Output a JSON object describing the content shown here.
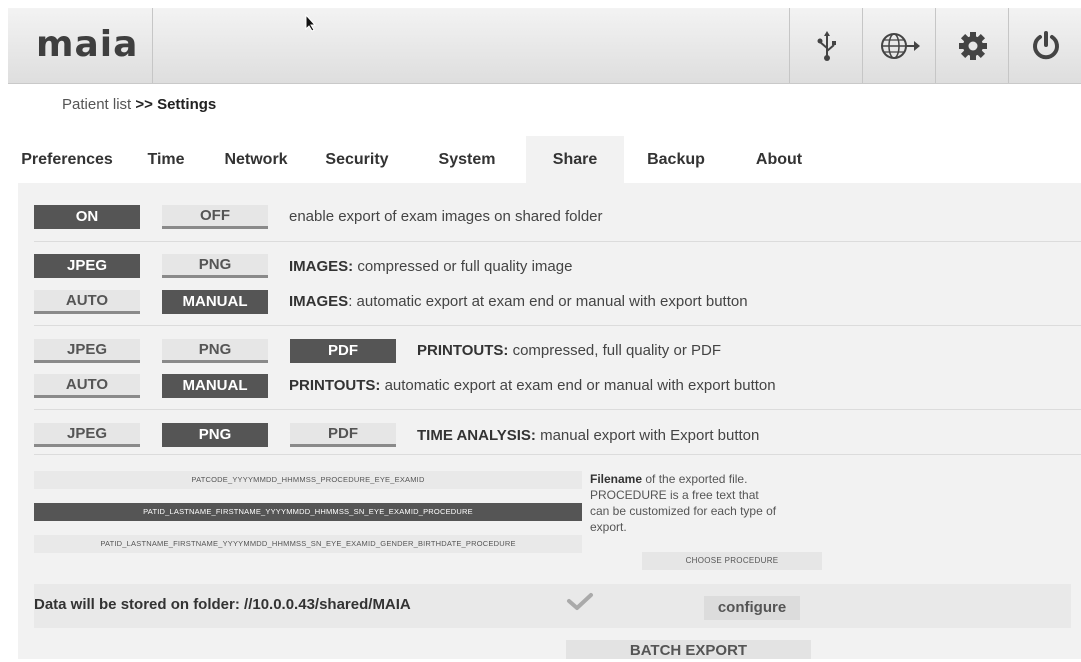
{
  "header": {
    "logo": "maia",
    "buttons": [
      {
        "name": "usb-icon"
      },
      {
        "name": "network-export-icon"
      },
      {
        "name": "gear-icon"
      },
      {
        "name": "power-icon"
      }
    ]
  },
  "breadcrumb": {
    "parent": "Patient list",
    "separator": " >> ",
    "current": "Settings"
  },
  "tabs": [
    "Preferences",
    "Time",
    "Network",
    "Security",
    "System",
    "Share",
    "Backup",
    "About"
  ],
  "active_tab": "Share",
  "share": {
    "enable_row": {
      "on": "ON",
      "off": "OFF",
      "selected": "ON",
      "desc": "enable export of exam images on shared folder"
    },
    "images_format": {
      "options": [
        "JPEG",
        "PNG"
      ],
      "selected": "JPEG",
      "desc_bold": "IMAGES:",
      "desc": " compressed or full quality image"
    },
    "images_mode": {
      "options": [
        "AUTO",
        "MANUAL"
      ],
      "selected": "MANUAL",
      "desc_bold": "IMAGES",
      "desc": ": automatic export at exam end or manual with export button"
    },
    "printouts_format": {
      "options": [
        "JPEG",
        "PNG",
        "PDF"
      ],
      "selected": "PDF",
      "desc_bold": "PRINTOUTS:",
      "desc": " compressed, full quality or PDF"
    },
    "printouts_mode": {
      "options": [
        "AUTO",
        "MANUAL"
      ],
      "selected": "MANUAL",
      "desc_bold": "PRINTOUTS:",
      "desc": " automatic export at exam end or manual with export button"
    },
    "time_analysis": {
      "options": [
        "JPEG",
        "PNG",
        "PDF"
      ],
      "selected": "PNG",
      "desc_bold": "TIME ANALYSIS:",
      "desc": " manual export with Export button"
    },
    "filenames": [
      "PATCODE_YYYYMMDD_HHMMSS_PROCEDURE_EYE_EXAMID",
      "PATID_LASTNAME_FIRSTNAME_YYYYMMDD_HHMMSS_SN_EYE_EXAMID_PROCEDURE",
      "PATID_LASTNAME_FIRSTNAME_YYYYMMDD_HHMMSS_SN_EYE_EXAMID_GENDER_BIRTHDATE_PROCEDURE"
    ],
    "filename_selected": 1,
    "filename_desc_bold": "Filename",
    "filename_desc": " of the exported file. PROCEDURE is a free text that can be customized for each type of export.",
    "choose_procedure": "CHOOSE PROCEDURE",
    "storage_text": "Data will be stored on folder: //10.0.0.43/shared/MAIA",
    "configure": "configure",
    "batch_export": "BATCH EXPORT"
  }
}
